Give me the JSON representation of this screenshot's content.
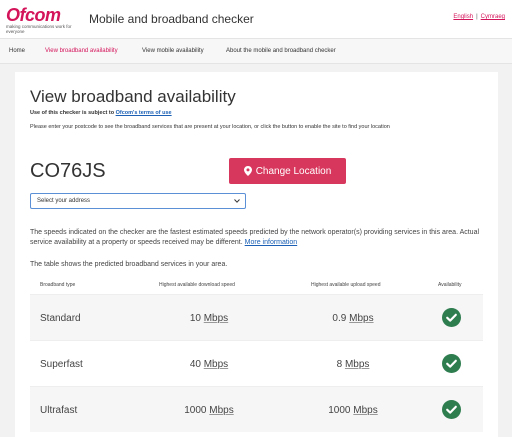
{
  "header": {
    "logo_word": "Ofcom",
    "logo_tagline": "making communications work for everyone",
    "site_title": "Mobile and broadband checker",
    "lang_english": "English",
    "lang_separator": "|",
    "lang_welsh": "Cymraeg"
  },
  "nav": [
    {
      "label": "Home",
      "active": false
    },
    {
      "label": "View broadband availability",
      "active": true
    },
    {
      "label": "View mobile availability",
      "active": false
    },
    {
      "label": "About the mobile and broadband checker",
      "active": false
    }
  ],
  "main": {
    "title": "View broadband availability",
    "terms_prefix": "Use of this checker is subject to ",
    "terms_link": "Ofcom's terms of use",
    "instruction": "Please enter your postcode to see the broadband services that are present at your location, or click the button to enable the site to find your location",
    "postcode": "CO76JS",
    "change_location_label": "Change Location",
    "address_select": {
      "selected": "Select your address"
    },
    "info_text": "The speeds indicated on the checker are the fastest estimated speeds predicted by the network operator(s) providing services in this area. Actual service availability at a property or speeds received may be different. ",
    "info_link": "More information",
    "table_intro": "The table shows the predicted broadband services in your area."
  },
  "table": {
    "headers": [
      "Broadband type",
      "Highest available download speed",
      "Highest available upload speed",
      "Availability"
    ],
    "rows": [
      {
        "type": "Standard",
        "download_value": "10",
        "download_unit": "Mbps",
        "upload_value": "0.9",
        "upload_unit": "Mbps",
        "available": true
      },
      {
        "type": "Superfast",
        "download_value": "40",
        "download_unit": "Mbps",
        "upload_value": "8",
        "upload_unit": "Mbps",
        "available": true
      },
      {
        "type": "Ultrafast",
        "download_value": "1000",
        "download_unit": "Mbps",
        "upload_value": "1000",
        "upload_unit": "Mbps",
        "available": true
      }
    ]
  },
  "colors": {
    "brand": "#d4145a",
    "button": "#d8375d",
    "link": "#1a5fb4",
    "check": "#2e7d4f"
  },
  "icons": {
    "pin": "map-pin-icon",
    "chevron": "chevron-down-icon",
    "check": "check-circle-icon"
  }
}
